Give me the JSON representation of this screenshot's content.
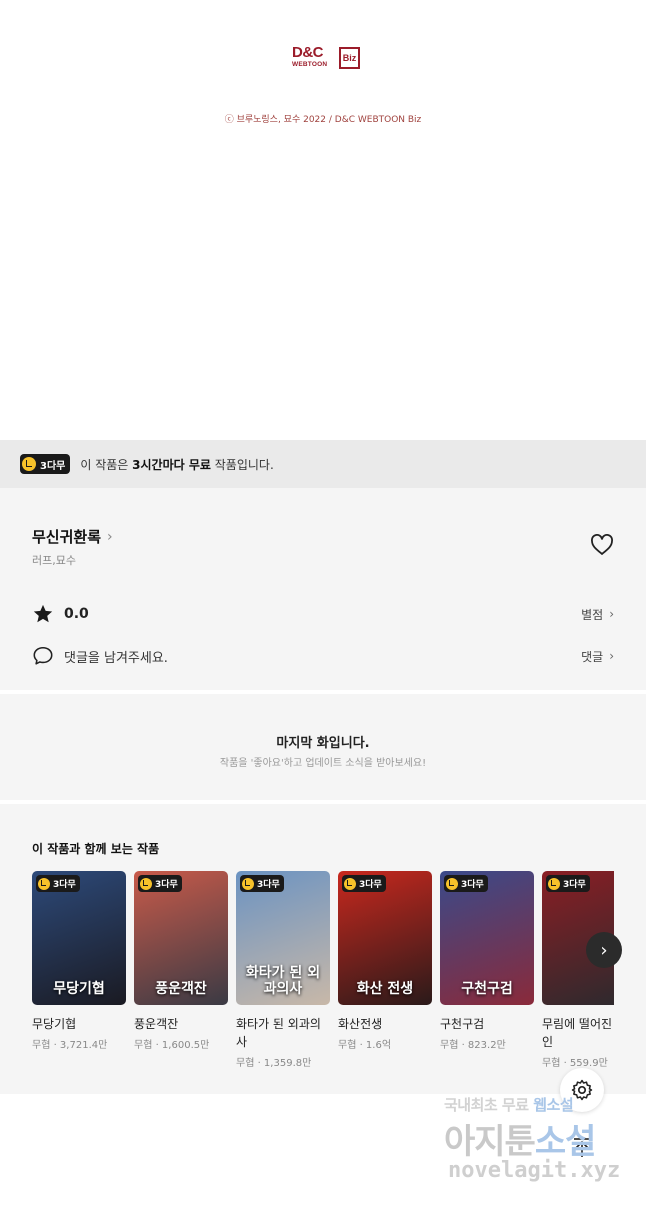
{
  "footer_brand": {
    "logo_text": "D&C",
    "logo_sub": "WEBTOON",
    "logo_biz": "Biz",
    "copyright": "ⓒ 브루노링스, 묘수 2022 / D&C WEBTOON Biz"
  },
  "free_banner": {
    "badge": "3다무",
    "text_prefix": "이 작품은 ",
    "text_bold": "3시간마다 무료",
    "text_suffix": " 작품입니다."
  },
  "series": {
    "title": "무신귀환록",
    "authors": "러프,묘수",
    "rating": "0.0",
    "rating_link": "별점",
    "comment_prompt": "댓글을 남겨주세요.",
    "comment_link": "댓글"
  },
  "last_episode": {
    "title": "마지막 화입니다.",
    "subtitle": "작품을 '좋아요'하고 업데이트 소식을 받아보세요!"
  },
  "recommendations": {
    "heading": "이 작품과 함께 보는 작품",
    "items": [
      {
        "title": "무당기협",
        "meta": "무협 · 3,721.4만",
        "badge": "3다무",
        "cover_text": "무당기협",
        "color_a": "#2d4a7a",
        "color_b": "#1a1a22"
      },
      {
        "title": "풍운객잔",
        "meta": "무협 · 1,600.5만",
        "badge": "3다무",
        "cover_text": "풍운객잔",
        "color_a": "#c85a4a",
        "color_b": "#3a3a44"
      },
      {
        "title": "화타가 된 외과의사",
        "meta": "무협 · 1,359.8만",
        "badge": "3다무",
        "cover_text": "화타가 된 외과의사",
        "color_a": "#6b93c2",
        "color_b": "#c8b8a8"
      },
      {
        "title": "화산전생",
        "meta": "무협 · 1.6억",
        "badge": "3다무",
        "cover_text": "화산 전생",
        "color_a": "#c8281e",
        "color_b": "#2a1a1a"
      },
      {
        "title": "구천구검",
        "meta": "무협 · 823.2만",
        "badge": "3다무",
        "cover_text": "구천구검",
        "color_a": "#3a4a8a",
        "color_b": "#8a2a3a"
      },
      {
        "title": "무림에 떨어진 대인",
        "meta": "무협 · 559.9만",
        "badge": "3다무",
        "cover_text": "",
        "color_a": "#8a1e24",
        "color_b": "#2a2a2e"
      }
    ]
  },
  "watermark": {
    "line1_a": "국내최초 무료 ",
    "line1_b": "웹소설",
    "line2_a": "아지툰",
    "line2_b": "소설",
    "line3": "novelagit.xyz"
  },
  "icons": {
    "heart": "heart-outline-icon",
    "star": "star-filled-icon",
    "comment": "speech-bubble-icon",
    "next": "chevron-right-icon",
    "settings": "gear-icon",
    "scroll_top": "arrow-up-icon"
  }
}
